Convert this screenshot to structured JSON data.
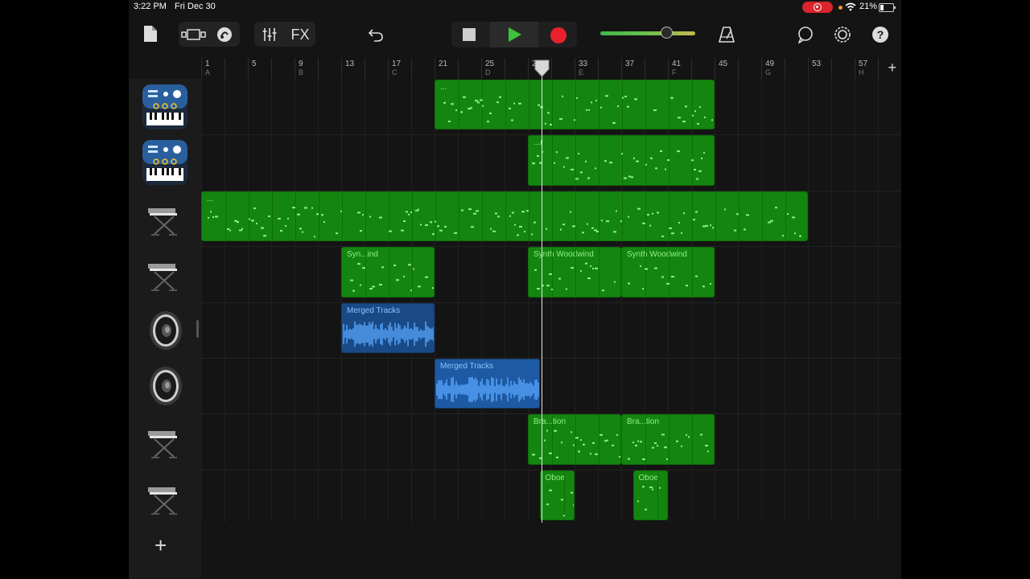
{
  "status_bar": {
    "time": "3:22 PM",
    "date": "Fri Dec 30",
    "battery": "21%"
  },
  "toolbar": {
    "fx_label": "FX",
    "icons": [
      "my-songs-icon",
      "view-toggle-icon",
      "loops-icon",
      "mixer-icon",
      "undo-icon",
      "stop-icon",
      "play-icon",
      "record-icon",
      "metronome-icon",
      "loop-record-icon",
      "settings-icon",
      "help-icon"
    ],
    "master_volume": 0.72
  },
  "ruler": {
    "bars": [
      "1",
      "5",
      "9",
      "13",
      "17",
      "21",
      "25",
      "29",
      "33",
      "37",
      "41",
      "45",
      "49",
      "53",
      "57"
    ],
    "sections": [
      "A",
      "B",
      "C",
      "D",
      "E",
      "F",
      "G",
      "H"
    ],
    "add_label": "+"
  },
  "tracks": [
    {
      "instrument": "alchemy-synth-icon",
      "regions": [
        {
          "label": "...",
          "start": 21,
          "end": 45
        }
      ]
    },
    {
      "instrument": "alchemy-synth-icon",
      "regions": [
        {
          "label": "...r",
          "start": 29,
          "end": 45
        }
      ]
    },
    {
      "instrument": "keyboard-icon",
      "regions": [
        {
          "label": "...",
          "start": 1,
          "end": 53
        }
      ]
    },
    {
      "instrument": "keyboard-icon",
      "regions": [
        {
          "label": "Syn...ind",
          "start": 13,
          "end": 21
        },
        {
          "label": "Synth Woodwind",
          "start": 29,
          "end": 37
        },
        {
          "label": "Synth Woodwind",
          "start": 37,
          "end": 45
        }
      ]
    },
    {
      "instrument": "speaker-icon",
      "regions": [
        {
          "label": "Merged Tracks",
          "start": 13,
          "end": 21
        }
      ]
    },
    {
      "instrument": "speaker-icon",
      "regions": [
        {
          "label": "Merged Tracks",
          "start": 21,
          "end": 30
        }
      ]
    },
    {
      "instrument": "keyboard-icon",
      "regions": [
        {
          "label": "Bra...tion",
          "start": 29,
          "end": 37
        },
        {
          "label": "Bra...tion",
          "start": 37,
          "end": 45
        }
      ]
    },
    {
      "instrument": "keyboard-icon",
      "regions": [
        {
          "label": "Oboe",
          "start": 30,
          "end": 33
        },
        {
          "label": "Oboe",
          "start": 38,
          "end": 41
        }
      ]
    }
  ],
  "add_track_label": "+",
  "colors": {
    "midi_region": "#14860f",
    "audio_region": "#194a86",
    "record": "#e8212b",
    "play": "#3cc43a"
  }
}
